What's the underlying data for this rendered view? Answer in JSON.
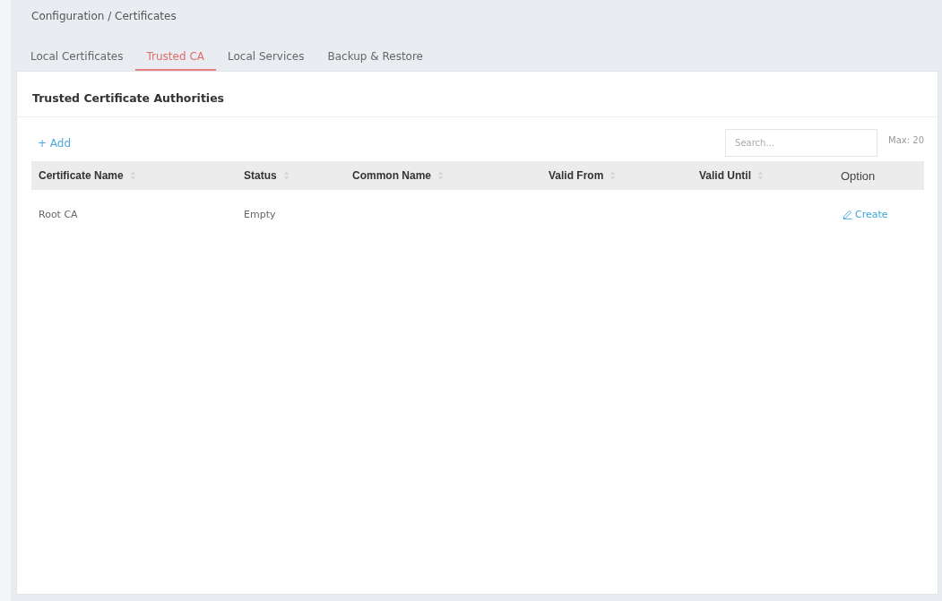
{
  "breadcrumb": "Configuration / Certificates",
  "tabs": [
    {
      "label": "Local Certificates",
      "selected": false
    },
    {
      "label": "Trusted CA",
      "selected": true
    },
    {
      "label": "Local Services",
      "selected": false
    },
    {
      "label": "Backup & Restore",
      "selected": false
    }
  ],
  "panel": {
    "title": "Trusted Certificate Authorities",
    "add_button": "+ Add",
    "search": {
      "placeholder": "Search..."
    },
    "max_label": "Max: 20"
  },
  "table": {
    "columns": [
      {
        "label": "Certificate Name",
        "sortable": true
      },
      {
        "label": "Status",
        "sortable": true
      },
      {
        "label": "Common Name",
        "sortable": true
      },
      {
        "label": "Valid From",
        "sortable": true
      },
      {
        "label": "Valid Until",
        "sortable": true
      },
      {
        "label": "Option",
        "sortable": false
      }
    ],
    "rows": [
      {
        "certificate_name": "Root CA",
        "status": "Empty",
        "action": "Create"
      }
    ]
  }
}
